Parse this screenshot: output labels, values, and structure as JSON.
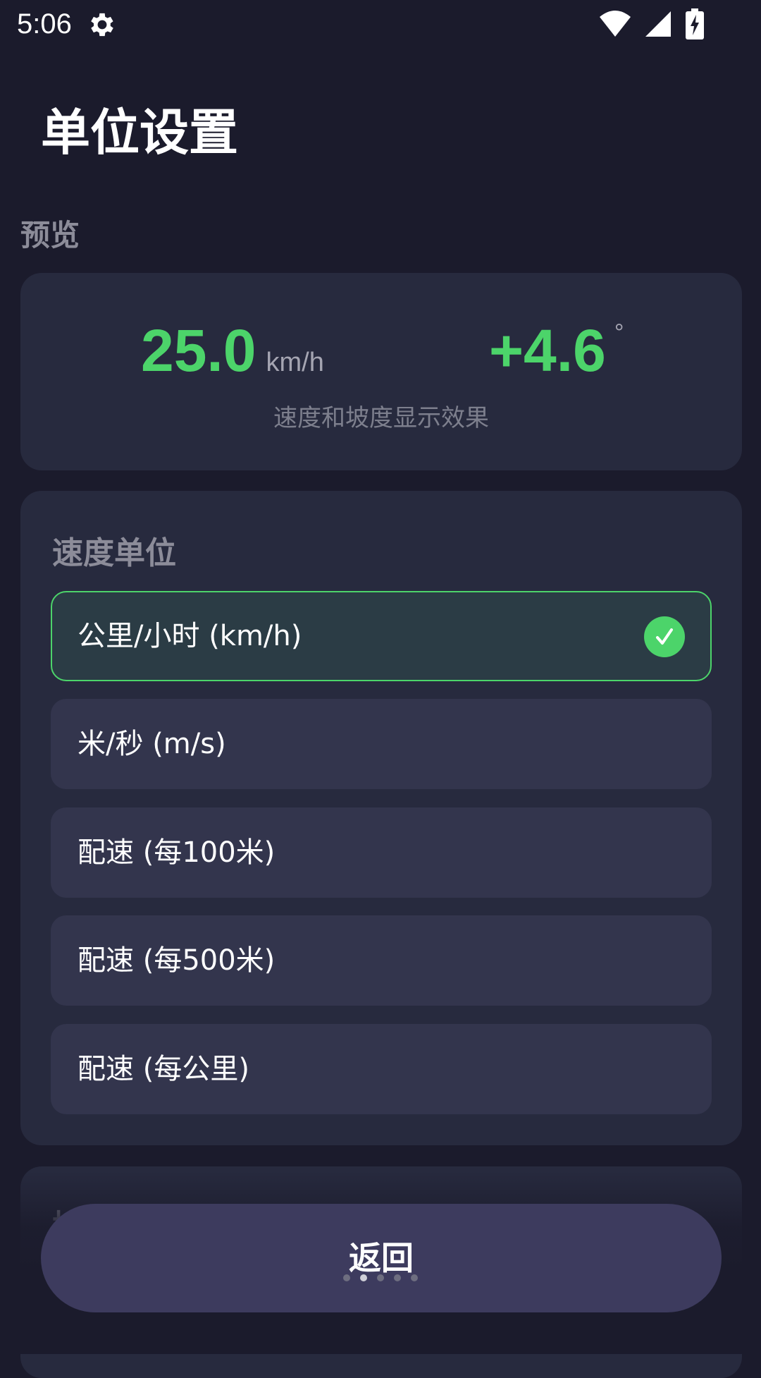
{
  "status_bar": {
    "time": "5:06",
    "icons": [
      "settings-gear-icon",
      "wifi-icon",
      "signal-icon",
      "battery-charging-icon"
    ]
  },
  "header": {
    "title": "单位设置"
  },
  "preview": {
    "section_label": "预览",
    "speed_value": "25.0",
    "speed_unit": "km/h",
    "slope_value": "+4.6",
    "slope_unit": "°",
    "caption": "速度和坡度显示效果"
  },
  "speed_unit": {
    "section_label": "速度单位",
    "options": [
      {
        "label": "公里/小时 (km/h)",
        "selected": true
      },
      {
        "label": "米/秒 (m/s)",
        "selected": false
      },
      {
        "label": "配速 (每100米)",
        "selected": false
      },
      {
        "label": "配速 (每500米)",
        "selected": false
      },
      {
        "label": "配速 (每公里)",
        "selected": false
      }
    ]
  },
  "next_section": {
    "label_partial": "坡"
  },
  "footer": {
    "back_label": "返回",
    "page_dots": 5,
    "active_dot": 1
  },
  "colors": {
    "accent": "#4cd46a",
    "background": "#1b1b2c",
    "card": "#272a3e",
    "option": "#33354d",
    "button": "#3d3b5e"
  }
}
